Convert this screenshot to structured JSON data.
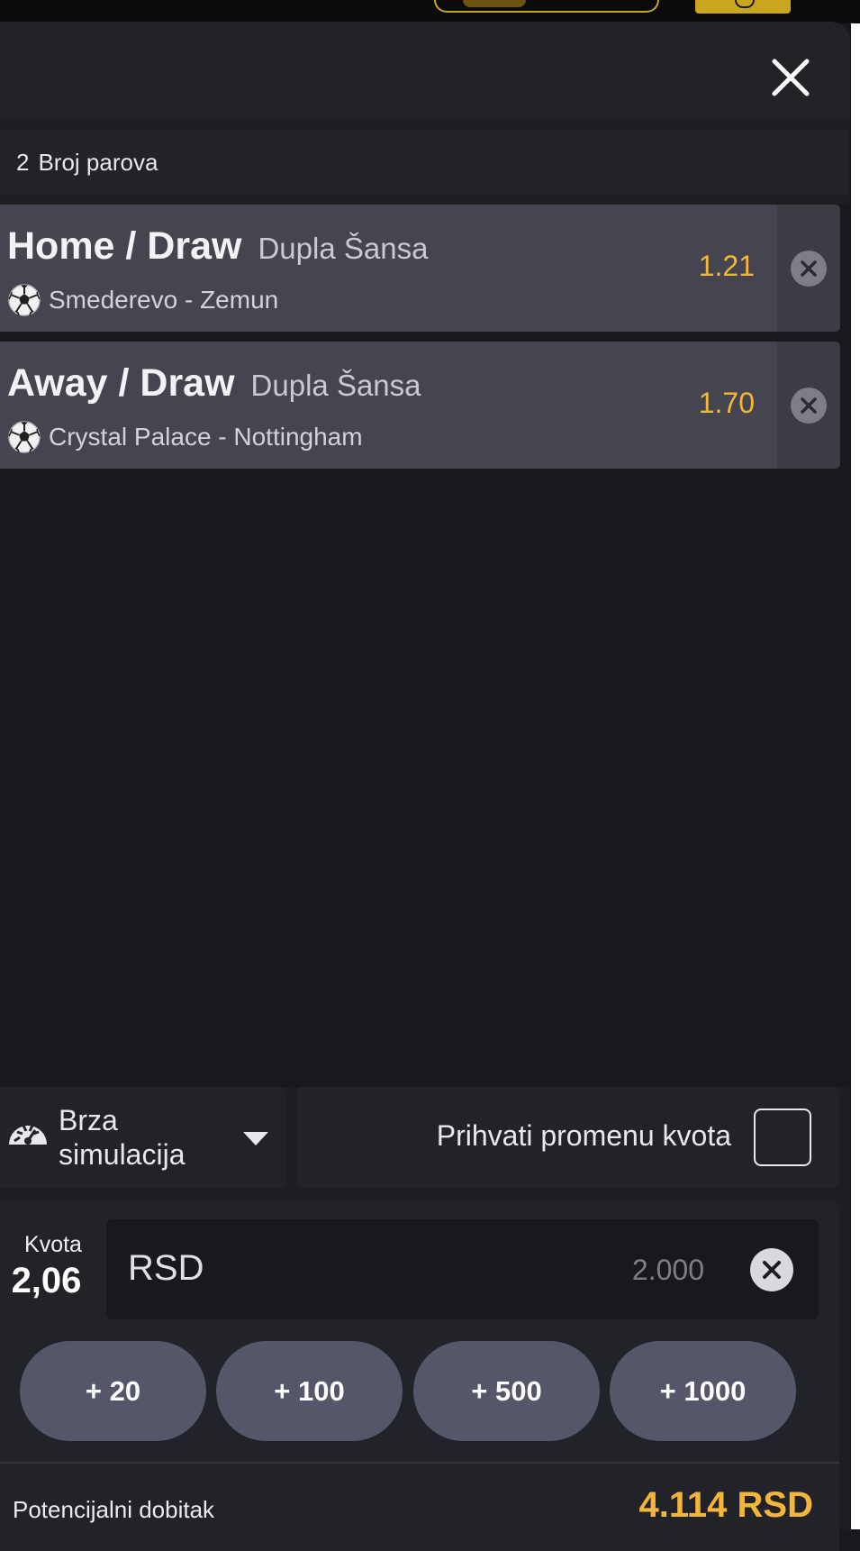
{
  "colors": {
    "background": "#18191d",
    "panel": "#222328",
    "bet_card": "#44454f",
    "accent_odds": "#f4b63a",
    "chip": "#55566a",
    "top_logo": "#c9a61e"
  },
  "header": {
    "close_icon": "close-icon"
  },
  "summary": {
    "pair_count": "2",
    "pair_count_label": "Broj parova"
  },
  "bets": [
    {
      "pick": "Home / Draw",
      "market": "Dupla Šansa",
      "sport_icon": "soccer-ball-icon",
      "match": "Smederevo - Zemun",
      "odd": "1.21",
      "remove_icon": "remove-circle-icon"
    },
    {
      "pick": "Away / Draw",
      "market": "Dupla Šansa",
      "sport_icon": "soccer-ball-icon",
      "match": "Crystal Palace - Nottingham",
      "odd": "1.70",
      "remove_icon": "remove-circle-icon"
    }
  ],
  "simulation": {
    "icon": "speedometer-icon",
    "label_line1": "Brza",
    "label_line2": "simulacija",
    "caret_icon": "caret-down-icon"
  },
  "accept_odds": {
    "label": "Prihvati promenu kvota",
    "checked": false
  },
  "stake": {
    "kvota_label": "Kvota",
    "kvota_value": "2,06",
    "currency": "RSD",
    "amount": "2.000",
    "clear_icon": "clear-circle-icon"
  },
  "quick_stakes": [
    "+ 20",
    "+ 100",
    "+ 500",
    "+ 1000"
  ],
  "payout": {
    "label": "Potencijalni dobitak",
    "value": "4.114 RSD"
  }
}
